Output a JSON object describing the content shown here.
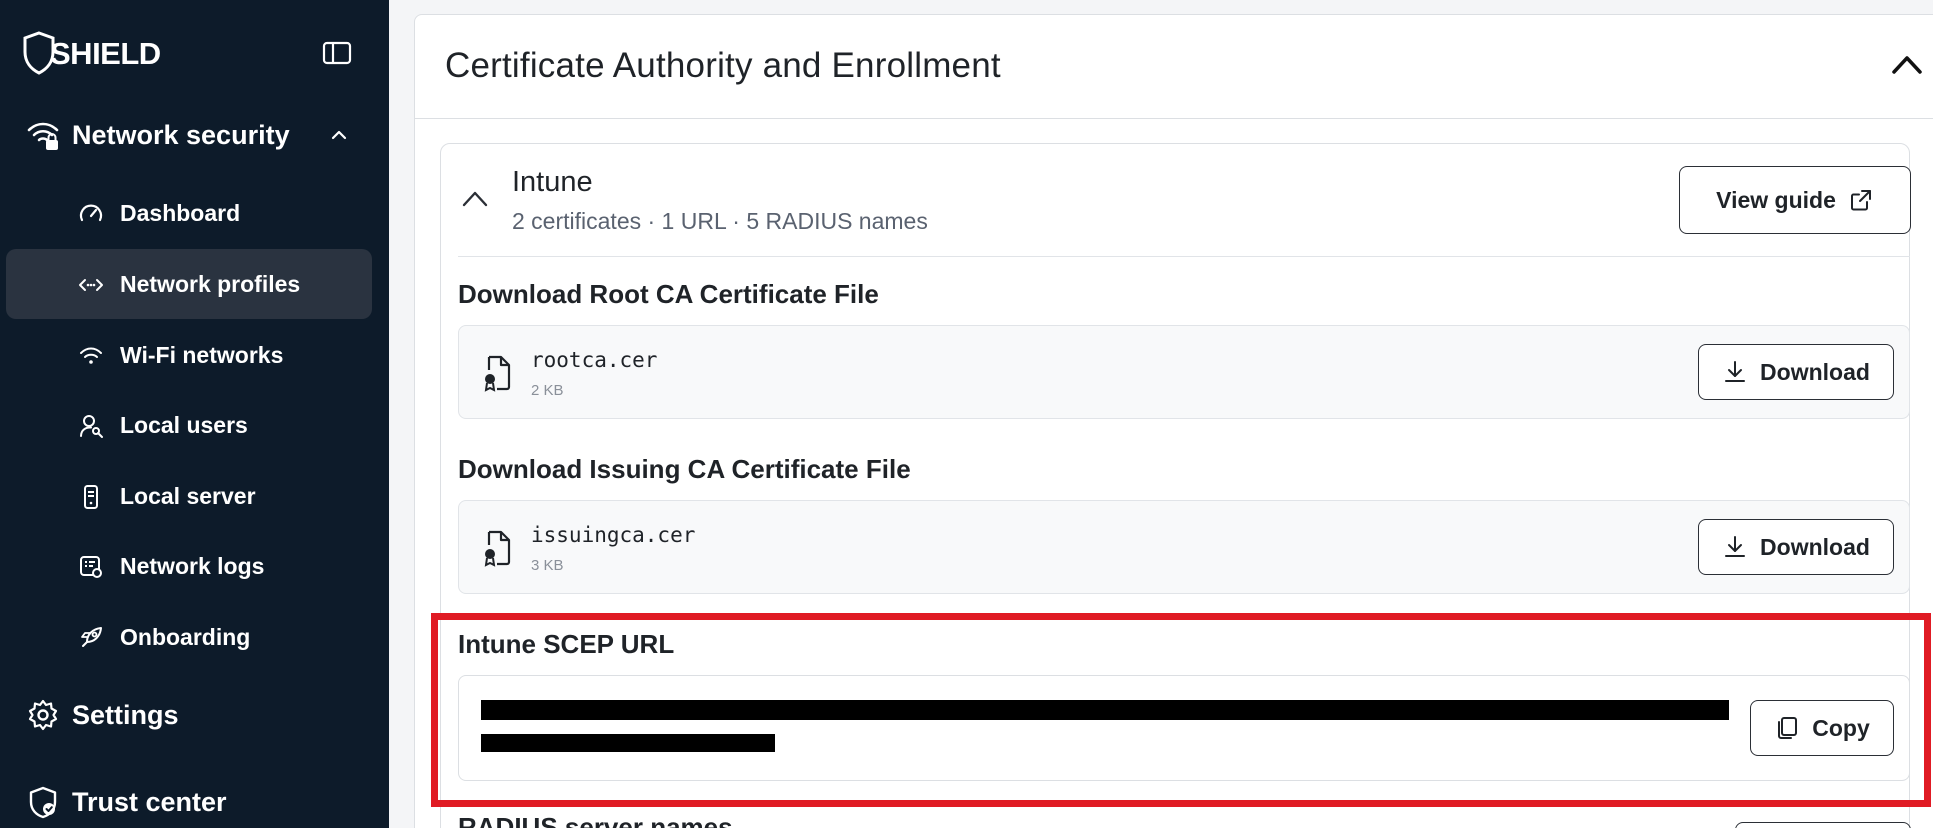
{
  "sidebar": {
    "logo_text": "SHIELD",
    "sections": [
      {
        "label": "Network security",
        "icon": "wifi-lock-icon"
      },
      {
        "label": "Settings",
        "icon": "gear-icon"
      },
      {
        "label": "Trust center",
        "icon": "shield-check-icon"
      }
    ],
    "items": [
      {
        "label": "Dashboard",
        "icon": "gauge-icon"
      },
      {
        "label": "Network profiles",
        "icon": "code-arrows-icon",
        "active": true
      },
      {
        "label": "Wi-Fi networks",
        "icon": "wifi-icon"
      },
      {
        "label": "Local users",
        "icon": "user-key-icon"
      },
      {
        "label": "Local server",
        "icon": "server-icon"
      },
      {
        "label": "Network logs",
        "icon": "logs-icon"
      },
      {
        "label": "Onboarding",
        "icon": "rocket-icon"
      }
    ]
  },
  "card": {
    "title": "Certificate Authority and Enrollment"
  },
  "intune": {
    "title": "Intune",
    "subtitle": "2 certificates · 1 URL · 5 RADIUS names",
    "view_guide_label": "View guide",
    "root_ca": {
      "section_title": "Download Root CA Certificate File",
      "file_name": "rootca.cer",
      "file_size": "2 KB",
      "button_label": "Download"
    },
    "issuing_ca": {
      "section_title": "Download Issuing CA Certificate File",
      "file_name": "issuingca.cer",
      "file_size": "3 KB",
      "button_label": "Download"
    },
    "scep": {
      "section_title": "Intune SCEP URL",
      "copy_label": "Copy"
    },
    "radius_peek": "RADIUS server names"
  },
  "colors": {
    "sidebar_bg": "#0d1b2a",
    "active_item_bg": "#2a3340",
    "highlight": "#e01b24"
  }
}
